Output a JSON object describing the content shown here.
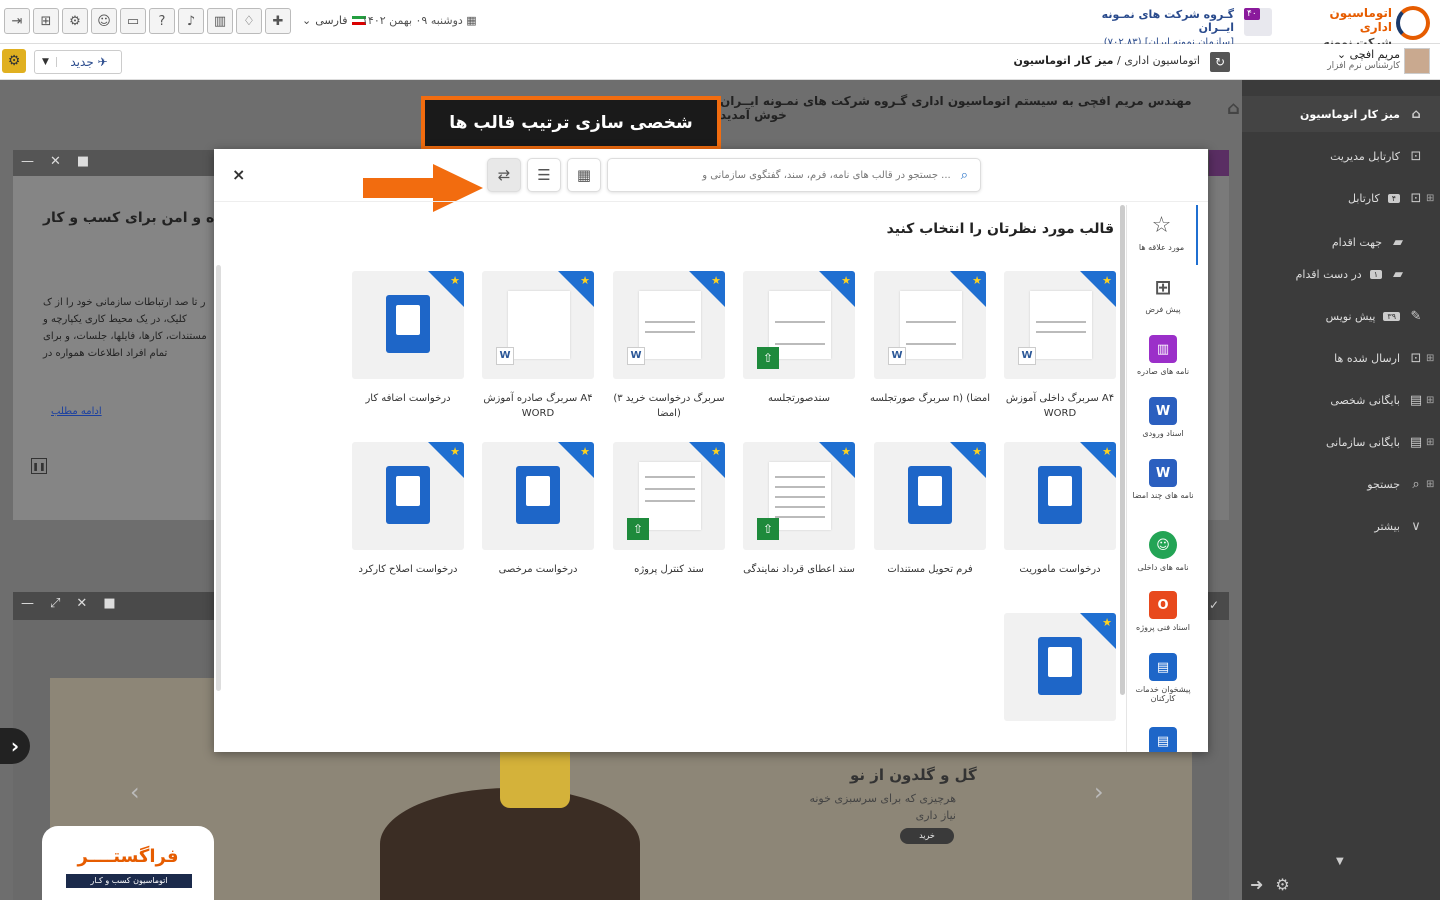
{
  "topbar": {
    "lang": "فارسی",
    "date": "دوشنبه ۰۹ بهمن ۱۴۰۲",
    "org_title": "گـروه شرکت های نمـونه ایــران",
    "org_sub": "[سازمان نمونه ایران]",
    "org_code": "(۷۰۲.۸۳)",
    "org_badge": "۴۰",
    "brand_title": "اتوماسیون اداری",
    "brand_sub": "شرکت نمونه ایران"
  },
  "bar2": {
    "new_label": "جدید",
    "breadcrumb_1": "اتوماسیون اداری",
    "breadcrumb_sep": "/",
    "breadcrumb_2": "میز کار اتوماسیون",
    "user_name": "مریم افچی",
    "user_role": "کارشناس نرم افزار"
  },
  "sidebar": {
    "items": [
      {
        "label": "میز کار اتوماسیون",
        "icon": "home-icon"
      },
      {
        "label": "کارتابل مدیریت",
        "icon": "inbox-icon"
      },
      {
        "label": "کارتابل",
        "badge": "۴",
        "icon": "inbox-icon"
      },
      {
        "label": "جهت اقدام",
        "icon": "folder-icon"
      },
      {
        "label": "در دست اقدام",
        "badge": "۱",
        "icon": "folder-icon"
      },
      {
        "label": "پیش نویس",
        "badge": "۳۹",
        "icon": "edit-icon"
      },
      {
        "label": "ارسال شده ها",
        "icon": "outbox-icon"
      },
      {
        "label": "بایگانی شخصی",
        "icon": "archive-icon"
      },
      {
        "label": "بایگانی سازمانی",
        "icon": "archive-icon"
      },
      {
        "label": "جستجو",
        "icon": "search-icon"
      },
      {
        "label": "بیشتر",
        "icon": "chevron-down-icon"
      }
    ]
  },
  "background": {
    "welcome": "مهندس مریم افچی به سیستم اتوماسیون اداری گـروه شرکت های نمـونه ایــران خوش آمدید",
    "panel_title": "ه و امن برای کسب و کار",
    "panel_para": "ر تا صد ارتباطات سازمانی خود را از ک کلیک، در یک محیط کاری یکپارچه و مستندات، کارها، فایلها، جلسات، و برای تمام افراد اطلاعات همواره در",
    "read_more": "ادامه مطلب",
    "hero_title": "گل و گلدون از نو",
    "hero_para": "هرچیزی که برای سرسبزی خونه نیاز داری",
    "hero_btn": "خرید",
    "logo_title": "فراگستــــر",
    "logo_sub": "اتوماسیون کسب و کـار"
  },
  "callout": {
    "text": "شخصی سازی ترتیب قالب ها"
  },
  "modal": {
    "search_placeholder": "جستجو در قالب های نامه، فرم، سند، گفتگوی سازمانی و ...",
    "heading": "قالب مورد نظرتان را انتخاب کنید",
    "close": "×",
    "nav": [
      {
        "label": "مورد علاقه ها",
        "icon": "star-icon"
      },
      {
        "label": "پیش فرض",
        "icon": "grid-plus-icon"
      },
      {
        "label": "نامه های صادره",
        "icon": "chart-icon"
      },
      {
        "label": "اسناد ورودی",
        "icon": "word-icon"
      },
      {
        "label": "نامه های چند امضا",
        "icon": "word-icon"
      },
      {
        "label": "نامه های داخلی",
        "icon": "group-icon"
      },
      {
        "label": "اسناد فنی پروژه",
        "icon": "office-icon"
      },
      {
        "label": "پیشخوان خدمات کارکنان",
        "icon": "form-icon"
      }
    ],
    "tiles": [
      {
        "label": "سربرگ داخلی آموزش A۴ WORD",
        "kind": "sheet-orange",
        "badge": "W"
      },
      {
        "label": "سربرگ صورتجلسه n) (امضا",
        "kind": "sheet-lines",
        "badge": "W"
      },
      {
        "label": "سندصورتجلسه",
        "kind": "sheet-lines",
        "badge": "up"
      },
      {
        "label": "سربرگ درخواست خرید ۳) (امضا",
        "kind": "sheet-orange",
        "badge": "W"
      },
      {
        "label": "سربرگ صادره آموزش A۴ WORD",
        "kind": "sheet-blank",
        "badge": "W"
      },
      {
        "label": "درخواست اضافه کار",
        "kind": "doc",
        "badge": ""
      },
      {
        "label": "درخواست ماموریت",
        "kind": "doc",
        "badge": ""
      },
      {
        "label": "فرم تحویل مستندات",
        "kind": "doc",
        "badge": ""
      },
      {
        "label": "سند اعطای قرداد نمایندگی",
        "kind": "sheet-dots",
        "badge": "up"
      },
      {
        "label": "سند کنترل پروژه",
        "kind": "sheet-table",
        "badge": "up"
      },
      {
        "label": "درخواست مرخصی",
        "kind": "doc",
        "badge": ""
      },
      {
        "label": "درخواست اصلاح کارکرد",
        "kind": "doc",
        "badge": ""
      },
      {
        "label": "",
        "kind": "doc",
        "badge": ""
      }
    ]
  }
}
